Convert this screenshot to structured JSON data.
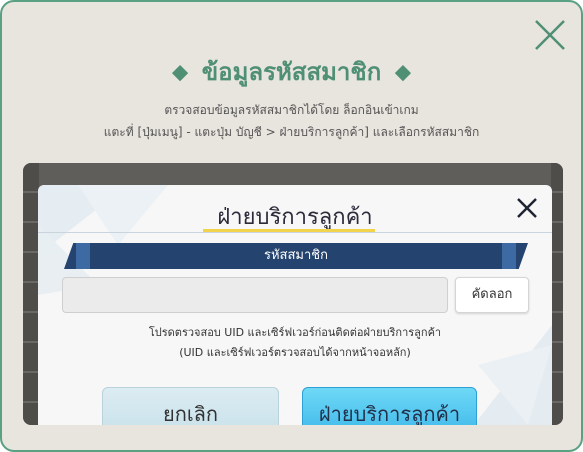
{
  "dialog": {
    "title": "ข้อมูลรหัสสมาชิก",
    "description_line1": "ตรวจสอบข้อมูลรหัสสมาชิกได้โดย ล็อกอินเข้าเกม",
    "description_line2": "แตะที่ [ปุ่มเมนู] - แตะปุ่ม บัญชี > ฝ่ายบริการลูกค้า] และเลือกรหัสสมาชิก"
  },
  "panel": {
    "title": "ฝ่ายบริการลูกค้า",
    "banner_label": "รหัสสมาชิก",
    "uid_value": "",
    "copy_label": "คัดลอก",
    "note_line1": "โปรดตรวจสอบ UID และเซิร์ฟเวอร์ก่อนติดต่อฝ่ายบริการลูกค้า",
    "note_line2": "(UID และเซิร์ฟเวอร์ตรวจสอบได้จากหน้าจอหลัก)",
    "cancel_label": "ยกเลิก",
    "support_label": "ฝ่ายบริการลูกค้า"
  },
  "colors": {
    "accent_green": "#4f8f74",
    "banner_navy": "#24436e",
    "support_blue": "#3fb8ea",
    "underline_yellow": "#f2d34c"
  },
  "icons": [
    "close-icon",
    "diamond-icon",
    "panel-close-icon"
  ]
}
